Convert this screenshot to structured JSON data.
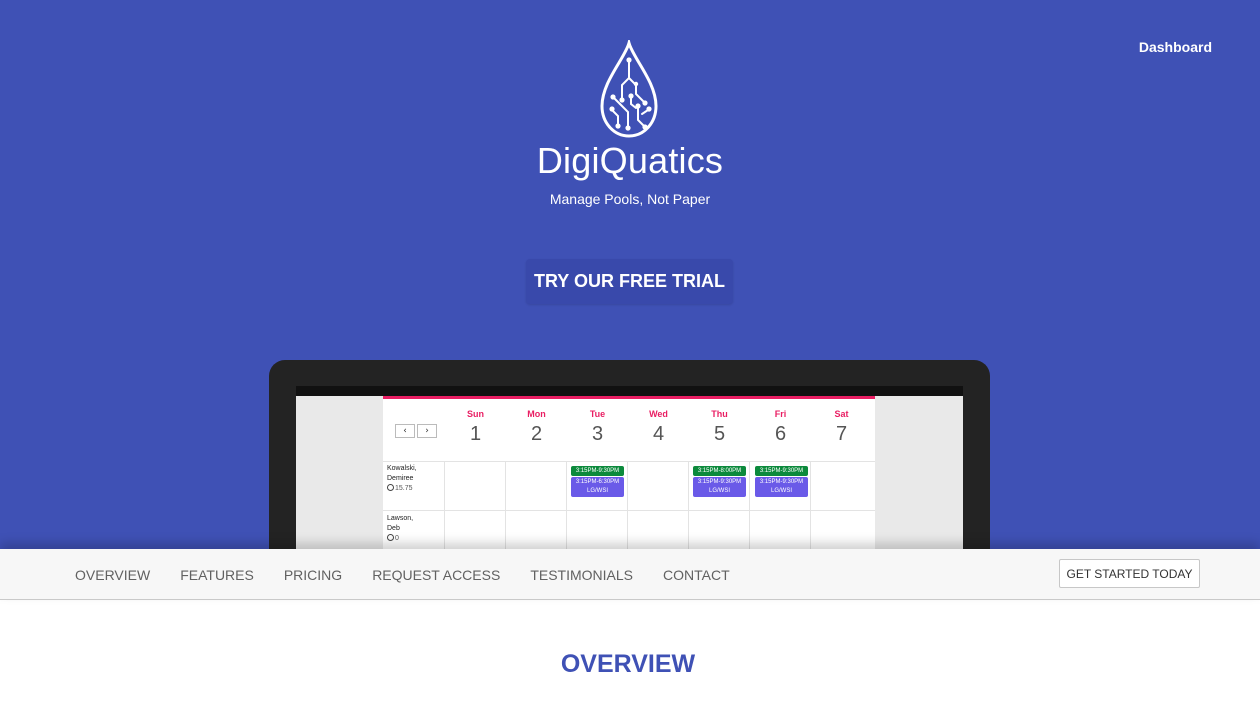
{
  "header": {
    "dashboard_link": "Dashboard"
  },
  "hero": {
    "brand": "DigiQuatics",
    "tagline": "Manage Pools, Not Paper",
    "trial_button": "TRY OUR FREE TRIAL"
  },
  "calendar": {
    "prev": "‹",
    "next": "›",
    "days": [
      {
        "name": "Sun",
        "date": "1"
      },
      {
        "name": "Mon",
        "date": "2"
      },
      {
        "name": "Tue",
        "date": "3"
      },
      {
        "name": "Wed",
        "date": "4"
      },
      {
        "name": "Thu",
        "date": "5"
      },
      {
        "name": "Fri",
        "date": "6"
      },
      {
        "name": "Sat",
        "date": "7"
      }
    ],
    "rows": [
      {
        "name_line1": "Kowalski,",
        "name_line2": "Demiree",
        "hours": "15.75",
        "shifts": [
          {
            "day": "Tue",
            "top": "3:15PM-9:30PM",
            "bottom_time": "3:15PM-6:30PM",
            "bottom_role": "LG/WSI"
          },
          {
            "day": "Thu",
            "top": "3:15PM-8:00PM",
            "bottom_time": "3:15PM-9:30PM",
            "bottom_role": "LG/WSI"
          },
          {
            "day": "Fri",
            "top": "3:15PM-9:30PM",
            "bottom_time": "3:15PM-9:30PM",
            "bottom_role": "LG/WSI"
          }
        ]
      },
      {
        "name_line1": "Lawson,",
        "name_line2": "Deb",
        "hours": "0"
      }
    ]
  },
  "nav": {
    "items": [
      "OVERVIEW",
      "FEATURES",
      "PRICING",
      "REQUEST ACCESS",
      "TESTIMONIALS",
      "CONTACT"
    ],
    "cta": "GET STARTED TODAY"
  },
  "section": {
    "title": "OVERVIEW"
  },
  "colors": {
    "primary": "#3f51b5",
    "accent": "#e91e63",
    "shift_green": "#0c8a3c",
    "shift_purple": "#6a5ae8"
  },
  "icons": {
    "logo": "water-drop-circuit-logo",
    "clock": "clock-icon"
  }
}
